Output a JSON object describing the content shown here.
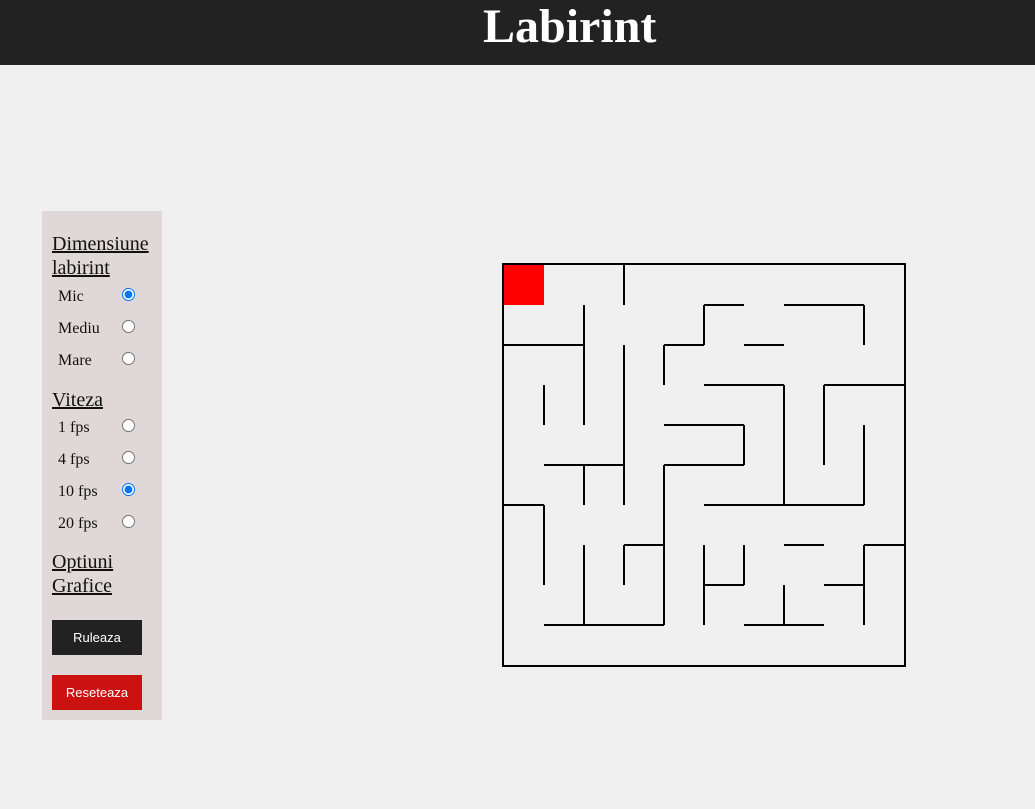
{
  "header": {
    "title": "Labirint"
  },
  "panel": {
    "size_title": "Dimensiune labirint",
    "size_options": [
      {
        "label": "Mic",
        "checked": true
      },
      {
        "label": "Mediu",
        "checked": false
      },
      {
        "label": "Mare",
        "checked": false
      }
    ],
    "speed_title": "Viteza",
    "speed_options": [
      {
        "label": "1 fps",
        "checked": false
      },
      {
        "label": "4 fps",
        "checked": false
      },
      {
        "label": "10 fps",
        "checked": true
      },
      {
        "label": "20 fps",
        "checked": false
      }
    ],
    "graphics_title": "Optiuni Grafice",
    "run_label": "Ruleaza",
    "reset_label": "Reseteaza"
  },
  "maze": {
    "grid_size": 10,
    "start_cell": [
      0,
      0
    ],
    "colors": {
      "wall": "#000000",
      "start": "#ff0000"
    },
    "walls": [
      [
        3,
        0,
        3,
        1
      ],
      [
        2,
        1,
        2,
        4
      ],
      [
        3,
        2,
        3,
        6
      ],
      [
        4,
        2,
        4,
        3
      ],
      [
        5,
        1,
        5,
        2
      ],
      [
        9,
        1,
        9,
        2
      ],
      [
        1,
        3,
        1,
        4
      ],
      [
        7,
        3,
        7,
        6
      ],
      [
        8,
        3,
        8,
        5
      ],
      [
        6,
        4,
        6,
        5
      ],
      [
        9,
        4,
        9,
        6
      ],
      [
        2,
        5,
        2,
        6
      ],
      [
        1,
        6,
        1,
        8
      ],
      [
        4,
        5,
        4,
        9
      ],
      [
        2,
        7,
        2,
        9
      ],
      [
        3,
        7,
        3,
        8
      ],
      [
        5,
        7,
        5,
        9
      ],
      [
        6,
        7,
        6,
        8
      ],
      [
        7,
        8,
        7,
        9
      ],
      [
        9,
        7,
        9,
        9
      ],
      [
        5,
        1,
        6,
        1
      ],
      [
        7,
        1,
        9,
        1
      ],
      [
        0,
        2,
        2,
        2
      ],
      [
        4,
        2,
        5,
        2
      ],
      [
        6,
        2,
        7,
        2
      ],
      [
        5,
        3,
        7,
        3
      ],
      [
        8,
        3,
        10,
        3
      ],
      [
        4,
        4,
        6,
        4
      ],
      [
        1,
        5,
        3,
        5
      ],
      [
        4,
        5,
        6,
        5
      ],
      [
        0,
        6,
        1,
        6
      ],
      [
        5,
        6,
        9,
        6
      ],
      [
        3,
        7,
        4,
        7
      ],
      [
        7,
        7,
        8,
        7
      ],
      [
        9,
        7,
        10,
        7
      ],
      [
        5,
        8,
        6,
        8
      ],
      [
        8,
        8,
        9,
        8
      ],
      [
        1,
        9,
        4,
        9
      ],
      [
        6,
        9,
        8,
        9
      ]
    ]
  }
}
